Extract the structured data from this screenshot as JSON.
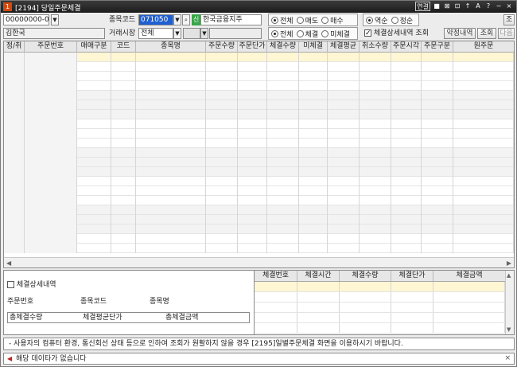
{
  "window": {
    "number": "1",
    "title": "[2194] 당일주문체결",
    "toolbar_icons": [
      "연결",
      "■",
      "⊠",
      "⊡",
      "↑",
      "A",
      "?",
      "−",
      "×"
    ]
  },
  "filters": {
    "account": "00000000-00",
    "account_name": "김한국",
    "stock_code_label": "종목코드",
    "stock_code": "071050",
    "stock_badge": "신",
    "stock_name": "한국금융지주",
    "market_label": "거래시장",
    "market_value": "전체",
    "radio_side": {
      "all": "전체",
      "sell": "매도",
      "buy": "매수"
    },
    "radio_fill": {
      "all": "전체",
      "filled": "체결",
      "unfilled": "미체결"
    },
    "radio_order": {
      "desc": "역순",
      "asc": "정순"
    },
    "detail_check_label": "체결상세내역 조회",
    "btn_query_top": "조",
    "btn_contract": "약정내역",
    "btn_query": "조회",
    "btn_next": "다음"
  },
  "grid": {
    "columns": [
      "정/취",
      "주문번호",
      "매매구분",
      "코드",
      "종목명",
      "주문수량",
      "주문단가",
      "체결수량",
      "미체결",
      "체결평균",
      "취소수량",
      "주문시각",
      "주문구분",
      "원주문"
    ]
  },
  "detail": {
    "section_label": "체결상세내역",
    "order_no": "주문번호",
    "stock_code": "종목코드",
    "stock_name": "종목명",
    "total_qty": "총체결수량",
    "avg_price": "체결평균단가",
    "total_amount": "총체결금액",
    "columns": [
      "체결번호",
      "체결시간",
      "체결수량",
      "체결단가",
      "체결금액"
    ]
  },
  "notice": "- 사용자의 컴퓨터 환경, 통신회선 상태 등으로 인하여 조회가 원활하지 않을 경우 [2195]일별주문체결 화면을 이용하시기 바랍니다.",
  "status": "해당 데이타가 없습니다"
}
